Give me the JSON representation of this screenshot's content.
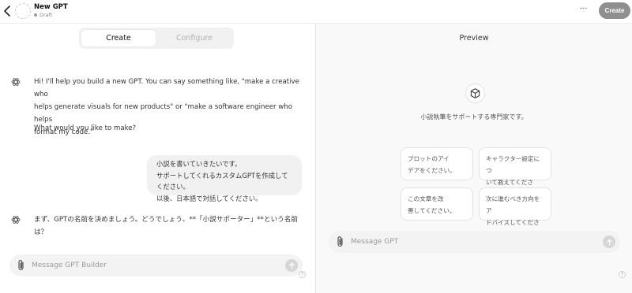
{
  "header": {
    "title": "New GPT",
    "status": "Draft",
    "more_label": "···",
    "create_label": "Create"
  },
  "builder": {
    "tabs": [
      {
        "label": "Create",
        "active": true
      },
      {
        "label": "Configure",
        "active": false
      }
    ],
    "messages": [
      {
        "role": "assistant",
        "lines": [
          "Hi! I'll help you build a new GPT. You can say something like, \"make a creative who",
          "helps generate visuals for new products\" or \"make a software engineer who helps",
          "format my code.\""
        ]
      },
      {
        "role": "assistant",
        "lines": [
          "What would you like to make?"
        ]
      },
      {
        "role": "user",
        "lines": [
          "小説を書いていきたいです。",
          "サポートしてくれるカスタムGPTを作成してください。",
          "以後、日本語で対話してください。"
        ]
      },
      {
        "role": "assistant",
        "lines": [
          "まず、GPTの名前を決めましょう。どうでしょう、**「小説サポーター」**という名前は？"
        ]
      }
    ],
    "composer_placeholder": "Message GPT Builder"
  },
  "preview": {
    "title": "Preview",
    "description": "小説執筆をサポートする専門家です。",
    "starters": [
      {
        "lines": [
          "プロットのアイ",
          "デアをください。"
        ]
      },
      {
        "lines": [
          "キャラクター設定につ",
          "いて教えてください。"
        ]
      },
      {
        "lines": [
          "この文章を改",
          "善してください。"
        ]
      },
      {
        "lines": [
          "次に進むべき方向をア",
          "ドバイスしてください。"
        ]
      }
    ],
    "composer_placeholder": "Message GPT"
  },
  "help_label": "?",
  "icons": {
    "back": "chevron-left-icon",
    "avatar": "gpt-avatar-placeholder",
    "bot": "openai-logo-icon",
    "attach": "paperclip-icon",
    "send": "arrow-up-icon",
    "cube": "cube-icon"
  },
  "colors": {
    "create_button": "#8f8f8f",
    "bubble": "#f1f1f1",
    "preview_bg": "#f9f9f9"
  }
}
